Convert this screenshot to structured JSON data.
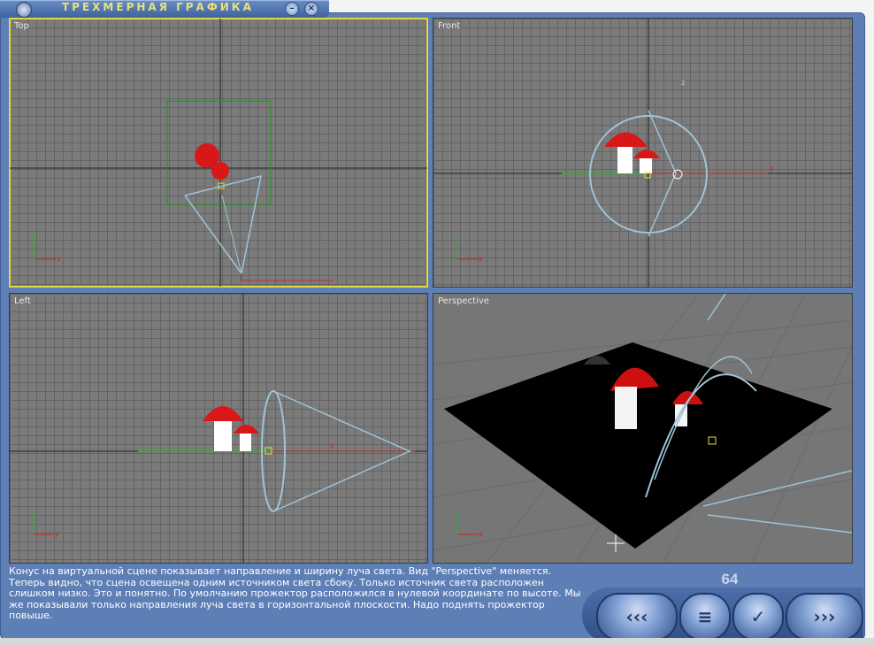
{
  "window": {
    "title": "ТРЕХМЕРНАЯ ГРАФИКА",
    "minimize_glyph": "–",
    "close_glyph": "×"
  },
  "viewports": {
    "top": {
      "label": "Top"
    },
    "front": {
      "label": "Front"
    },
    "left": {
      "label": "Left"
    },
    "perspective": {
      "label": "Perspective"
    }
  },
  "axis_labels": {
    "x": "x",
    "y": "y",
    "z": "z"
  },
  "description": "Конус на виртуальной сцене показывает направление и ширину луча света. Вид \"Perspective\" меняется. Теперь видно, что сцена освещена одним источником света сбоку. Только источник света расположен слишком низко. Это и понятно. По умолчанию прожектор расположился в нулевой координате по высоте. Мы же показывали только направления луча света в горизонтальной плоскости. Надо поднять прожектор повыше.",
  "page_number": "64",
  "nav": {
    "back_glyph": "‹‹‹",
    "menu_glyph": "≡",
    "check_glyph": "✓",
    "forward_glyph": "›››"
  },
  "colors": {
    "frame": "#5e7fb6",
    "active_border": "#e4d93a",
    "title_text": "#e8e078",
    "viewport_bg": "#7b7b7b",
    "mushroom_cap": "#cc1010"
  },
  "icons": [
    "app-icon",
    "minimize-icon",
    "close-icon",
    "back-arrow-icon",
    "menu-icon",
    "check-icon",
    "forward-arrow-icon"
  ]
}
